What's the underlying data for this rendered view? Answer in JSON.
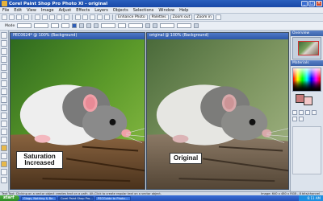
{
  "window": {
    "title": "Corel Paint Shop Pro Photo XI - original"
  },
  "menu": {
    "items": [
      "File",
      "Edit",
      "View",
      "Image",
      "Adjust",
      "Effects",
      "Layers",
      "Objects",
      "Selections",
      "Window",
      "Help"
    ]
  },
  "toolbar": {
    "enhance_photo": "Enhance Photo",
    "palettes": "Palettes",
    "zoom_out": "Zoom out",
    "zoom_in": "Zoom in"
  },
  "options": {
    "label": "Mode"
  },
  "documents": [
    {
      "title": "PEC0624* @ 100% (Background)",
      "caption_line1": "Saturation",
      "caption_line2": "Increased"
    },
    {
      "title": "original @ 100% (Background)",
      "caption": "Original"
    }
  ],
  "panels": {
    "overview": "Overview",
    "materials": "Materials"
  },
  "status": {
    "text": "Text Tool: Clicking on a vector object creates text on a path. Alt-Click to create regular text on a vector object.",
    "image_info": "Image: 640 x 480 x RGB - 8 bits/channel"
  },
  "taskbar": {
    "start": "start",
    "tasks": [
      "Glogs, Nothing & Be...",
      "Corel Paint Shop Pro...",
      "PSCGuide to Photo..."
    ],
    "time": "6:11 AM"
  },
  "colors": {
    "title_blue": "#2a5fbd",
    "taskbar_blue": "#2452b8",
    "start_green": "#3a9a2e",
    "foreground_swatch": "#c77a7a"
  }
}
